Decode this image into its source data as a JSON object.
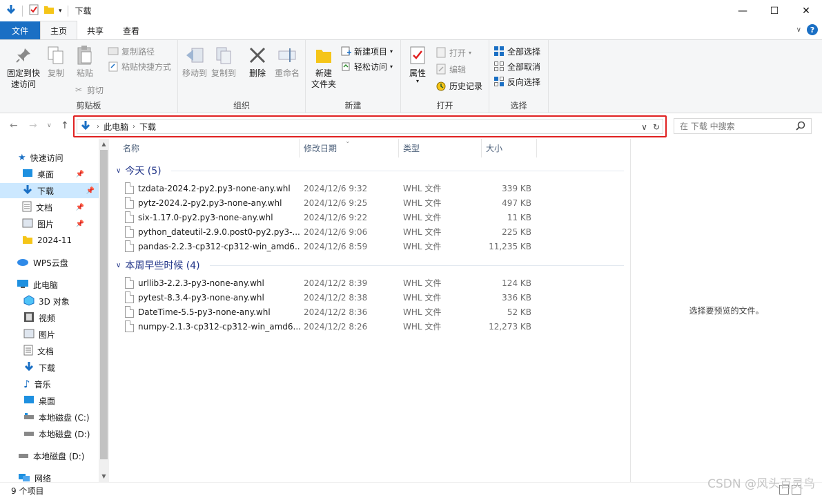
{
  "window": {
    "title": "下载",
    "minimize": "—",
    "maximize": "☐",
    "close": "✕"
  },
  "ribbon_tabs": [
    "文件",
    "主页",
    "共享",
    "查看"
  ],
  "ribbon": {
    "clipboard": {
      "label": "剪贴板",
      "pin": "固定到快\n速访问",
      "pin_l1": "固定到快",
      "pin_l2": "速访问",
      "copy": "复制",
      "paste": "粘贴",
      "copy_path": "复制路径",
      "paste_shortcut": "粘贴快捷方式",
      "cut": "剪切"
    },
    "organize": {
      "label": "组织",
      "move_to": "移动到",
      "copy_to": "复制到",
      "delete": "删除",
      "rename": "重命名"
    },
    "new": {
      "label": "新建",
      "new_folder_l1": "新建",
      "new_folder_l2": "文件夹",
      "new_item": "新建项目",
      "easy_access": "轻松访问"
    },
    "open": {
      "label": "打开",
      "properties": "属性",
      "open": "打开",
      "edit": "编辑",
      "history": "历史记录"
    },
    "select": {
      "label": "选择",
      "select_all": "全部选择",
      "select_none": "全部取消",
      "invert": "反向选择"
    }
  },
  "address": {
    "crumbs": [
      "此电脑",
      "下载"
    ],
    "search_placeholder": "在 下载 中搜索"
  },
  "nav": {
    "quick_access": "快速访问",
    "quick_items": [
      "桌面",
      "下载",
      "文档",
      "图片",
      "2024-11"
    ],
    "wps": "WPS云盘",
    "this_pc": "此电脑",
    "pc_items": [
      "3D 对象",
      "视频",
      "图片",
      "文档",
      "下载",
      "音乐",
      "桌面",
      "本地磁盘 (C:)",
      "本地磁盘 (D:)"
    ],
    "drive_d": "本地磁盘 (D:)",
    "network": "网络"
  },
  "columns": {
    "name": "名称",
    "date": "修改日期",
    "type": "类型",
    "size": "大小"
  },
  "groups": [
    {
      "title": "今天 (5)",
      "files": [
        {
          "name": "tzdata-2024.2-py2.py3-none-any.whl",
          "date": "2024/12/6 9:32",
          "type": "WHL 文件",
          "size": "339 KB"
        },
        {
          "name": "pytz-2024.2-py2.py3-none-any.whl",
          "date": "2024/12/6 9:25",
          "type": "WHL 文件",
          "size": "497 KB"
        },
        {
          "name": "six-1.17.0-py2.py3-none-any.whl",
          "date": "2024/12/6 9:22",
          "type": "WHL 文件",
          "size": "11 KB"
        },
        {
          "name": "python_dateutil-2.9.0.post0-py2.py3-...",
          "date": "2024/12/6 9:06",
          "type": "WHL 文件",
          "size": "225 KB"
        },
        {
          "name": "pandas-2.2.3-cp312-cp312-win_amd6...",
          "date": "2024/12/6 8:59",
          "type": "WHL 文件",
          "size": "11,235 KB"
        }
      ]
    },
    {
      "title": "本周早些时候 (4)",
      "files": [
        {
          "name": "urllib3-2.2.3-py3-none-any.whl",
          "date": "2024/12/2 8:39",
          "type": "WHL 文件",
          "size": "124 KB"
        },
        {
          "name": "pytest-8.3.4-py3-none-any.whl",
          "date": "2024/12/2 8:38",
          "type": "WHL 文件",
          "size": "336 KB"
        },
        {
          "name": "DateTime-5.5-py3-none-any.whl",
          "date": "2024/12/2 8:36",
          "type": "WHL 文件",
          "size": "52 KB"
        },
        {
          "name": "numpy-2.1.3-cp312-cp312-win_amd6...",
          "date": "2024/12/2 8:26",
          "type": "WHL 文件",
          "size": "12,273 KB"
        }
      ]
    }
  ],
  "preview_text": "选择要预览的文件。",
  "status": {
    "count": "9 个项目"
  },
  "watermark": "CSDN @风头百灵鸟",
  "colors": {
    "accent": "#1a6fc4",
    "highlight": "#e02020",
    "selected": "#cce8ff",
    "group_header": "#1e3287"
  }
}
